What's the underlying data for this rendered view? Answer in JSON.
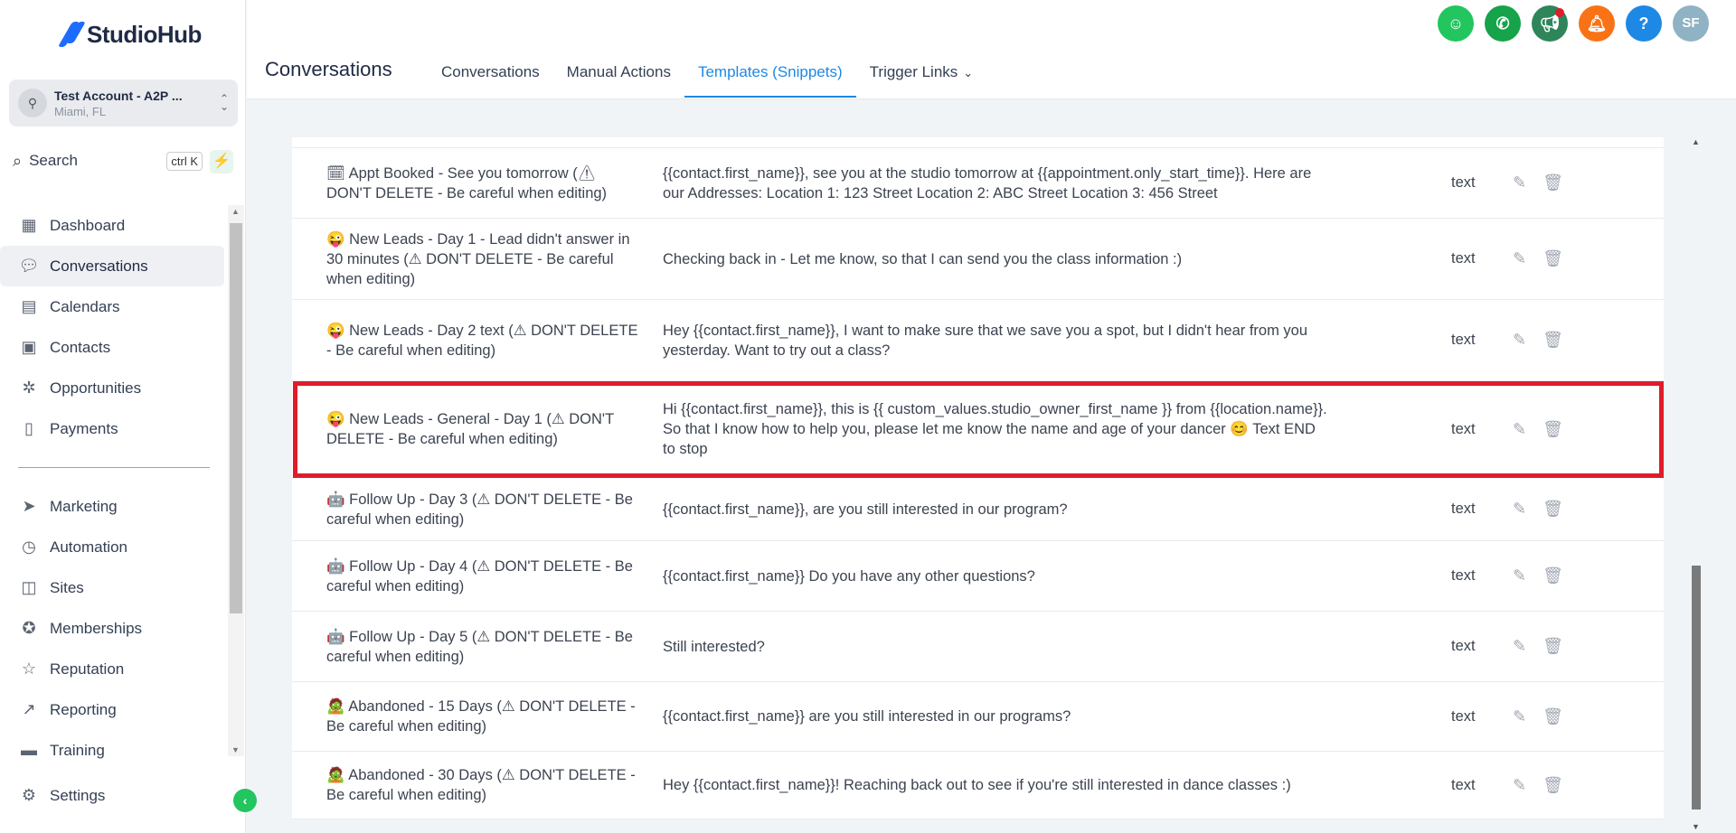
{
  "brand": {
    "name": "StudioHub",
    "color": "#1e6bff"
  },
  "account": {
    "name": "Test Account - A2P ...",
    "location": "Miami, FL"
  },
  "search": {
    "label": "Search",
    "shortcut": "ctrl K"
  },
  "sidebar": {
    "items": [
      {
        "label": "Dashboard",
        "icon": "dashboard-icon"
      },
      {
        "label": "Conversations",
        "icon": "chat-icon",
        "active": true
      },
      {
        "label": "Calendars",
        "icon": "calendar-icon"
      },
      {
        "label": "Contacts",
        "icon": "contacts-icon"
      },
      {
        "label": "Opportunities",
        "icon": "opportunities-icon"
      },
      {
        "label": "Payments",
        "icon": "payments-icon"
      },
      {
        "label": "Marketing",
        "icon": "send-icon"
      },
      {
        "label": "Automation",
        "icon": "automation-icon"
      },
      {
        "label": "Sites",
        "icon": "sites-icon"
      },
      {
        "label": "Memberships",
        "icon": "membership-icon"
      },
      {
        "label": "Reputation",
        "icon": "star-icon"
      },
      {
        "label": "Reporting",
        "icon": "chart-icon"
      },
      {
        "label": "Training",
        "icon": "book-icon"
      }
    ],
    "settings": "Settings"
  },
  "header": {
    "title": "Conversations",
    "tabs": [
      {
        "label": "Conversations"
      },
      {
        "label": "Manual Actions"
      },
      {
        "label": "Templates (Snippets)",
        "active": true
      },
      {
        "label": "Trigger Links"
      }
    ],
    "avatar_initials": "SF",
    "icon_colors": [
      "#22c55e",
      "#16a34a",
      "#2f855a",
      "#f97316",
      "#1e88e5",
      "#8fb3c4"
    ]
  },
  "templates": [
    {
      "name": "🗓 Appt Booked - See you tomorrow (⚠ DON'T DELETE - Be careful when editing)",
      "body": "{{contact.first_name}}, see you at the studio tomorrow at {{appointment.only_start_time}}. Here are our Addresses: Location 1: 123 Street Location 2: ABC Street Location 3: 456 Street",
      "type": "text"
    },
    {
      "name": "😜 New Leads - Day 1 - Lead didn't answer in 30 minutes (⚠ DON'T DELETE - Be careful when editing)",
      "body": "Checking back in - Let me know, so that I can send you the class information :)",
      "type": "text"
    },
    {
      "name": "😜 New Leads - Day 2 text (⚠ DON'T DELETE - Be careful when editing)",
      "body": "Hey {{contact.first_name}}, I want to make sure that we save you a spot, but I didn't hear from you yesterday. Want to try out a class?",
      "type": "text"
    },
    {
      "name": "😜 New Leads - General - Day 1 (⚠ DON'T DELETE - Be careful when editing)",
      "body": "Hi {{contact.first_name}}, this is {{ custom_values.studio_owner_first_name }} from {{location.name}}. So that I know how to help you, please let me know the name and age of your dancer 😊 Text END to stop",
      "type": "text"
    },
    {
      "name": "🤖 Follow Up - Day 3 (⚠ DON'T DELETE - Be careful when editing)",
      "body": "{{contact.first_name}}, are you still interested in our program?",
      "type": "text"
    },
    {
      "name": "🤖 Follow Up - Day 4 (⚠ DON'T DELETE - Be careful when editing)",
      "body": "{{contact.first_name}} Do you have any other questions?",
      "type": "text"
    },
    {
      "name": "🤖 Follow Up - Day 5 (⚠ DON'T DELETE - Be careful when editing)",
      "body": "Still interested?",
      "type": "text"
    },
    {
      "name": "🧟 Abandoned - 15 Days (⚠ DON'T DELETE - Be careful when editing)",
      "body": "{{contact.first_name}} are you still interested in our programs?",
      "type": "text"
    },
    {
      "name": "🧟 Abandoned - 30 Days (⚠ DON'T DELETE - Be careful when editing)",
      "body": "Hey {{contact.first_name}}! Reaching back out to see if you're still interested in dance classes :)",
      "type": "text"
    }
  ],
  "highlight_color": "#e01c2a"
}
